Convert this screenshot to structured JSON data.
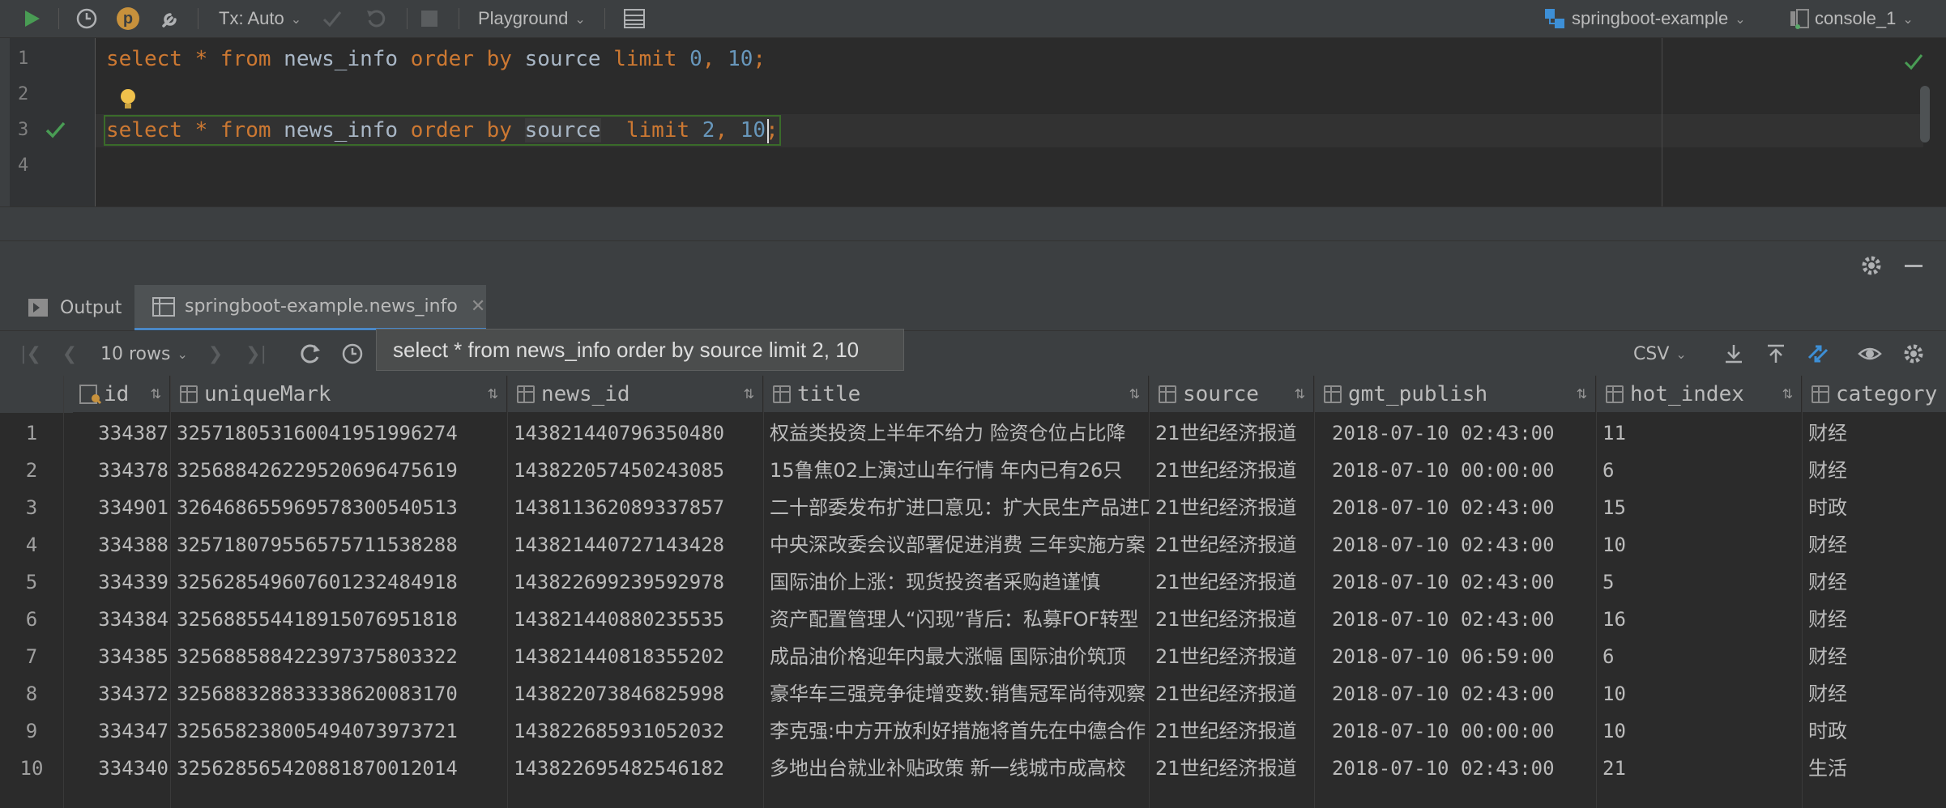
{
  "toolbar": {
    "tx_label": "Tx: Auto",
    "p_badge": "p",
    "playground_label": "Playground",
    "datasource": "springboot-example",
    "console": "console_1"
  },
  "editor": {
    "lines": [
      {
        "no": "1",
        "kw1": "select",
        "star": "*",
        "kw2": "from",
        "table": "news_info",
        "kw3": "order by",
        "col": "source",
        "kw4": "limit",
        "n1": "0",
        "comma": ",",
        "n2": "10",
        "semi": ";"
      },
      {
        "no": "2"
      },
      {
        "no": "3",
        "kw1": "select",
        "star": "*",
        "kw2": "from",
        "table": "news_info",
        "kw3": "order by",
        "col": "source",
        "kw4": "limit",
        "n1": "2",
        "comma": ",",
        "n2": "10",
        "semi": ";"
      },
      {
        "no": "4"
      }
    ]
  },
  "tabs": {
    "output": "Output",
    "result": "springboot-example.news_info"
  },
  "result_toolbar": {
    "rows": "10 rows",
    "export_format": "CSV",
    "tooltip": "select * from news_info order by source limit 2, 10"
  },
  "columns": [
    "id",
    "uniqueMark",
    "news_id",
    "title",
    "source",
    "gmt_publish",
    "hot_index",
    "category"
  ],
  "rows": [
    {
      "n": "1",
      "id": "334387",
      "uniqueMark": "325718053160041951996274",
      "news_id": "143821440796350480",
      "title": "权益类投资上半年不给力 险资仓位占比降",
      "source": "21世纪经济报道",
      "gmt_publish": "2018-07-10 02:43:00",
      "hot_index": "11",
      "category": "财经"
    },
    {
      "n": "2",
      "id": "334378",
      "uniqueMark": "325688426229520696475619",
      "news_id": "143822057450243085",
      "title": "15鲁焦02上演过山车行情 年内已有26只",
      "source": "21世纪经济报道",
      "gmt_publish": "2018-07-10 00:00:00",
      "hot_index": "6",
      "category": "财经"
    },
    {
      "n": "3",
      "id": "334901",
      "uniqueMark": "326468655969578300540513",
      "news_id": "143811362089337857",
      "title": "二十部委发布扩进口意见：扩大民生产品进口",
      "source": "21世纪经济报道",
      "gmt_publish": "2018-07-10 02:43:00",
      "hot_index": "15",
      "category": "时政"
    },
    {
      "n": "4",
      "id": "334388",
      "uniqueMark": "325718079556575711538288",
      "news_id": "143821440727143428",
      "title": "中央深改委会议部署促进消费 三年实施方案",
      "source": "21世纪经济报道",
      "gmt_publish": "2018-07-10 02:43:00",
      "hot_index": "10",
      "category": "财经"
    },
    {
      "n": "5",
      "id": "334339",
      "uniqueMark": "325628549607601232484918",
      "news_id": "143822699239592978",
      "title": "国际油价上涨：现货投资者采购趋谨慎",
      "source": "21世纪经济报道",
      "gmt_publish": "2018-07-10 02:43:00",
      "hot_index": "5",
      "category": "财经"
    },
    {
      "n": "6",
      "id": "334384",
      "uniqueMark": "325688554418915076951818",
      "news_id": "143821440880235535",
      "title": "资产配置管理人“闪现”背后：私募FOF转型",
      "source": "21世纪经济报道",
      "gmt_publish": "2018-07-10 02:43:00",
      "hot_index": "16",
      "category": "财经"
    },
    {
      "n": "7",
      "id": "334385",
      "uniqueMark": "325688588422397375803322",
      "news_id": "143821440818355202",
      "title": "成品油价格迎年内最大涨幅 国际油价筑顶",
      "source": "21世纪经济报道",
      "gmt_publish": "2018-07-10 06:59:00",
      "hot_index": "6",
      "category": "财经"
    },
    {
      "n": "8",
      "id": "334372",
      "uniqueMark": "325688328833338620083170",
      "news_id": "143822073846825998",
      "title": "豪华车三强竞争徒增变数:销售冠军尚待观察",
      "source": "21世纪经济报道",
      "gmt_publish": "2018-07-10 02:43:00",
      "hot_index": "10",
      "category": "财经"
    },
    {
      "n": "9",
      "id": "334347",
      "uniqueMark": "325658238005494073973721",
      "news_id": "143822685931052032",
      "title": "李克强:中方开放利好措施将首先在中德合作",
      "source": "21世纪经济报道",
      "gmt_publish": "2018-07-10 00:00:00",
      "hot_index": "10",
      "category": "时政"
    },
    {
      "n": "10",
      "id": "334340",
      "uniqueMark": "325628565420881870012014",
      "news_id": "143822695482546182",
      "title": "多地出台就业补贴政策 新一线城市成高校",
      "source": "21世纪经济报道",
      "gmt_publish": "2018-07-10 02:43:00",
      "hot_index": "21",
      "category": "生活"
    }
  ]
}
